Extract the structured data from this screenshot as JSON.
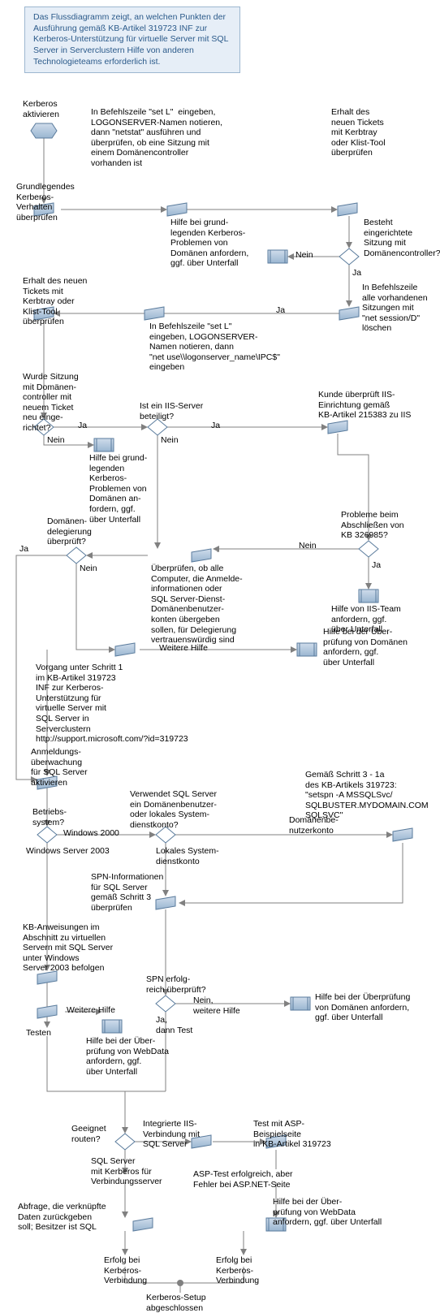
{
  "info": "Das Flussdiagramm zeigt, an welchen Punkten der Ausführung gemäß KB-Artikel 319723 INF zur Kerberos-Unterstützung für virtuelle Server mit SQL Server in Serverclustern Hilfe von anderen Technologieteams erforderlich ist.",
  "n": {
    "activate": "Kerberos\naktivieren",
    "step_setL": "In Befehlszeile \"set L\"  eingeben,\nLOGONSERVER-Namen notieren,\ndann \"netstat\" ausführen und\nüberprüfen, ob eine Sitzung mit\neinem Domänencontroller\nvorhanden ist",
    "check_new_ticket_r": "Erhalt des\nneuen Tickets\nmit Kerbtray\noder Klist-Tool\nüberprüfen",
    "basic_behavior": "Grundlegendes\nKerberos-\nVerhalten\nüberprüfen",
    "help_basic_domain_1": "Hilfe bei grund-\nlegenden Kerberos-\nProblemen von\nDomänen anfordern,\nggf. über Unterfall",
    "session_exists": "Besteht\neingerichtete\nSitzung mit\nDomänencontroller?",
    "check_new_ticket_l": "Erhalt des neuen\nTickets mit\nKerbtray oder\nKlist-Tool\nüberprüfen",
    "clear_sessions": "In Befehlszeile\nalle vorhandenen\nSitzungen mit\n\"net session/D\"\nlöschen",
    "step_setL2": "In Befehlszeile \"set L\"\neingeben, LOGONSERVER-\nNamen notieren, dann\n\"net use\\\\logonserver_name\\IPC$\"\neingeben",
    "session_new_ticket": "Wurde Sitzung\nmit Domänen-\ncontroller mit\nneuem Ticket\nneu einge-\nrichtet?",
    "iis_involved": "Ist ein IIS-Server\nbeteiligt?",
    "iis_check_kb": "Kunde überprüft IIS-\nEinrichtung gemäß\nKB-Artikel 215383 zu IIS",
    "help_basic_domain_2": "Hilfe bei grund-\nlegenden\nKerberos-\nProblemen von\nDomänen an-\nfordern, ggf.\nüber Unterfall",
    "delegation_checked": "Domänen-\ndelegierung\nüberprüft?",
    "kb326985_problems": "Probleme beim\nAbschließen von\nKB 326985?",
    "check_delegation_trusted": "Überprüfen, ob alle\nComputer, die Anmelde-\ninformationen oder\nSQL Server-Dienst-\nDomänenbenutzer-\nkonten übergeben\nsollen, für Delegierung\nvertrauenswürdig sind",
    "help_iis": "Hilfe von IIS-Team\nanfordern, ggf.\nüber Unterfall",
    "more_help_1": "Weitere Hilfe",
    "help_domain_check": "Hilfe bei der Über-\nprüfung von Domänen\nanfordern, ggf.\nüber Unterfall",
    "step1_kb319723": "Vorgang unter Schritt 1\nim KB-Artikel 319723\nINF zur Kerberos-\nUnterstützung für\nvirtuelle Server mit\nSQL Server in\nServerclustern\nhttp://support.microsoft.com/?id=319723",
    "enable_login_audit": "Anmeldungs-\nüberwachung\nfür SQL Server\naktivieren",
    "os": "Betriebs-\nsystem?",
    "sql_account_type": "Verwendet SQL Server\nein Domänenbenutzer-\noder lokales System-\ndienstkonto?",
    "kb319723_step31a": "Gemäß Schritt 3 - 1a\ndes KB-Artikels 319723:\n\"setspn -A MSSQLSvc/\nSQLBUSTER.MYDOMAIN.COM\nSQLSVC\"",
    "os_w2000": "Windows 2000",
    "os_w2003": "Windows Server 2003",
    "acct_local": "Lokales System-\ndienstkonto",
    "acct_domain": "Domänenbe-\nnutzerkonto",
    "spn_check_step3": "SPN-Informationen\nfür SQL Server\ngemäß Schritt 3\nüberprüfen",
    "kb_vs_2003": "KB-Anweisungen im\nAbschnitt zu virtuellen\nServern mit SQL Server\nunter Windows\nServer 2003 befolgen",
    "spn_success": "SPN erfolg-\nreich überprüft?",
    "more_help_2": "Weitere Hilfe",
    "test_label": "Testen",
    "help_webdata_1": "Hilfe bei der Über-\nprüfung von WebData\nanfordern, ggf.\nüber Unterfall",
    "help_domain_check2": "Hilfe bei der Überprüfung\nvon Domänen anfordern,\nggf. über Unterfall",
    "route_suitable": "Geeignet\nrouten?",
    "iis_integrated": "Integrierte IIS-\nVerbindung mit\nSQL Server",
    "test_asp_kb": "Test mit ASP-\nBeispielseite\nin KB-Artikel 319723",
    "sql_linked": "SQL Server\nmit Kerberos für\nVerbindungsserver",
    "asp_success_net_fail": "ASP-Test erfolgreich, aber\nFehler bei ASP.NET-Seite",
    "query_linked": "Abfrage, die verknüpfte\nDaten zurückgeben\nsoll; Besitzer ist SQL",
    "help_webdata_2": "Hilfe bei der Über-\nprüfung von WebData\nanfordern, ggf. über Unterfall",
    "success1": "Erfolg bei\nKerberos-\nVerbindung",
    "success2": "Erfolg bei\nKerberos-\nVerbindung",
    "setup_done": "Kerberos-Setup\nabgeschlossen",
    "ja": "Ja",
    "nein": "Nein",
    "ja_test": "Ja,\ndann Test",
    "nein_more": "Nein,\nweitere Hilfe"
  }
}
